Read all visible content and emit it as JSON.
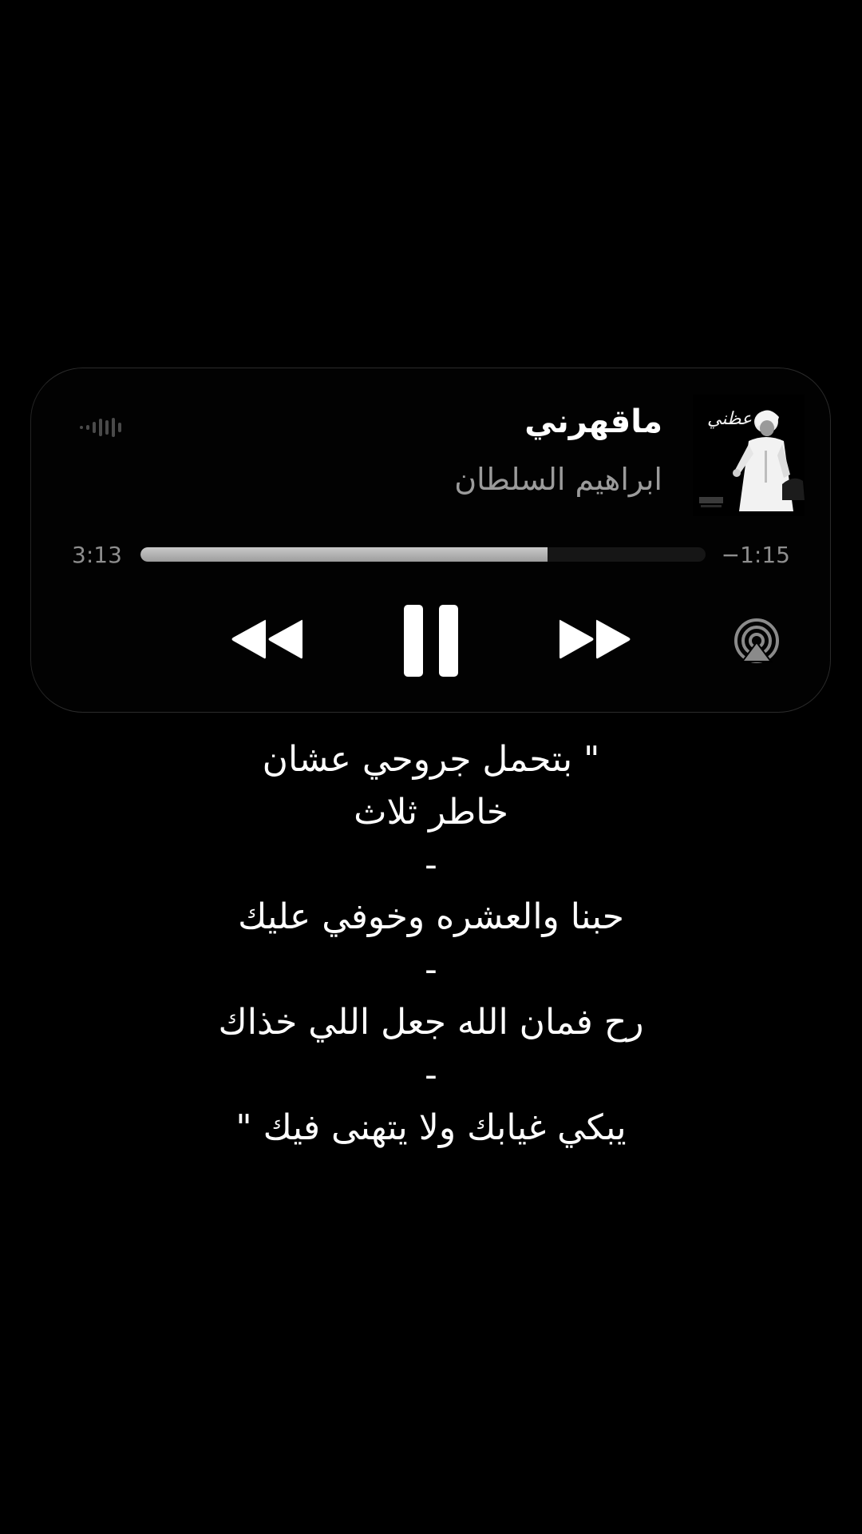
{
  "player": {
    "title": "ماقهرني",
    "artist": "ابراهيم السلطان",
    "artwork_text": "عظني",
    "elapsed": "3:13",
    "remaining": "−1:15",
    "progress": 0.72
  },
  "controls": {
    "icons": [
      "waveform-icon",
      "rewind-icon",
      "pause-icon",
      "fast-forward-icon",
      "airplay-icon"
    ]
  },
  "lyrics": [
    "\" بتحمل جروحي عشان",
    "خاطر ثلاث",
    "-",
    "حبنا والعشره وخوفي عليك",
    "-",
    "رح فمان الله جعل اللي خذاك",
    "-",
    "يبكي غيابك ولا يتهنى فيك \""
  ],
  "colors": {
    "background": "#000000",
    "title": "#ffffff",
    "artist": "#9b9b9b",
    "time": "#8e8e8e",
    "progress_fill": "#b5b5b5",
    "progress_track": "#161616"
  }
}
